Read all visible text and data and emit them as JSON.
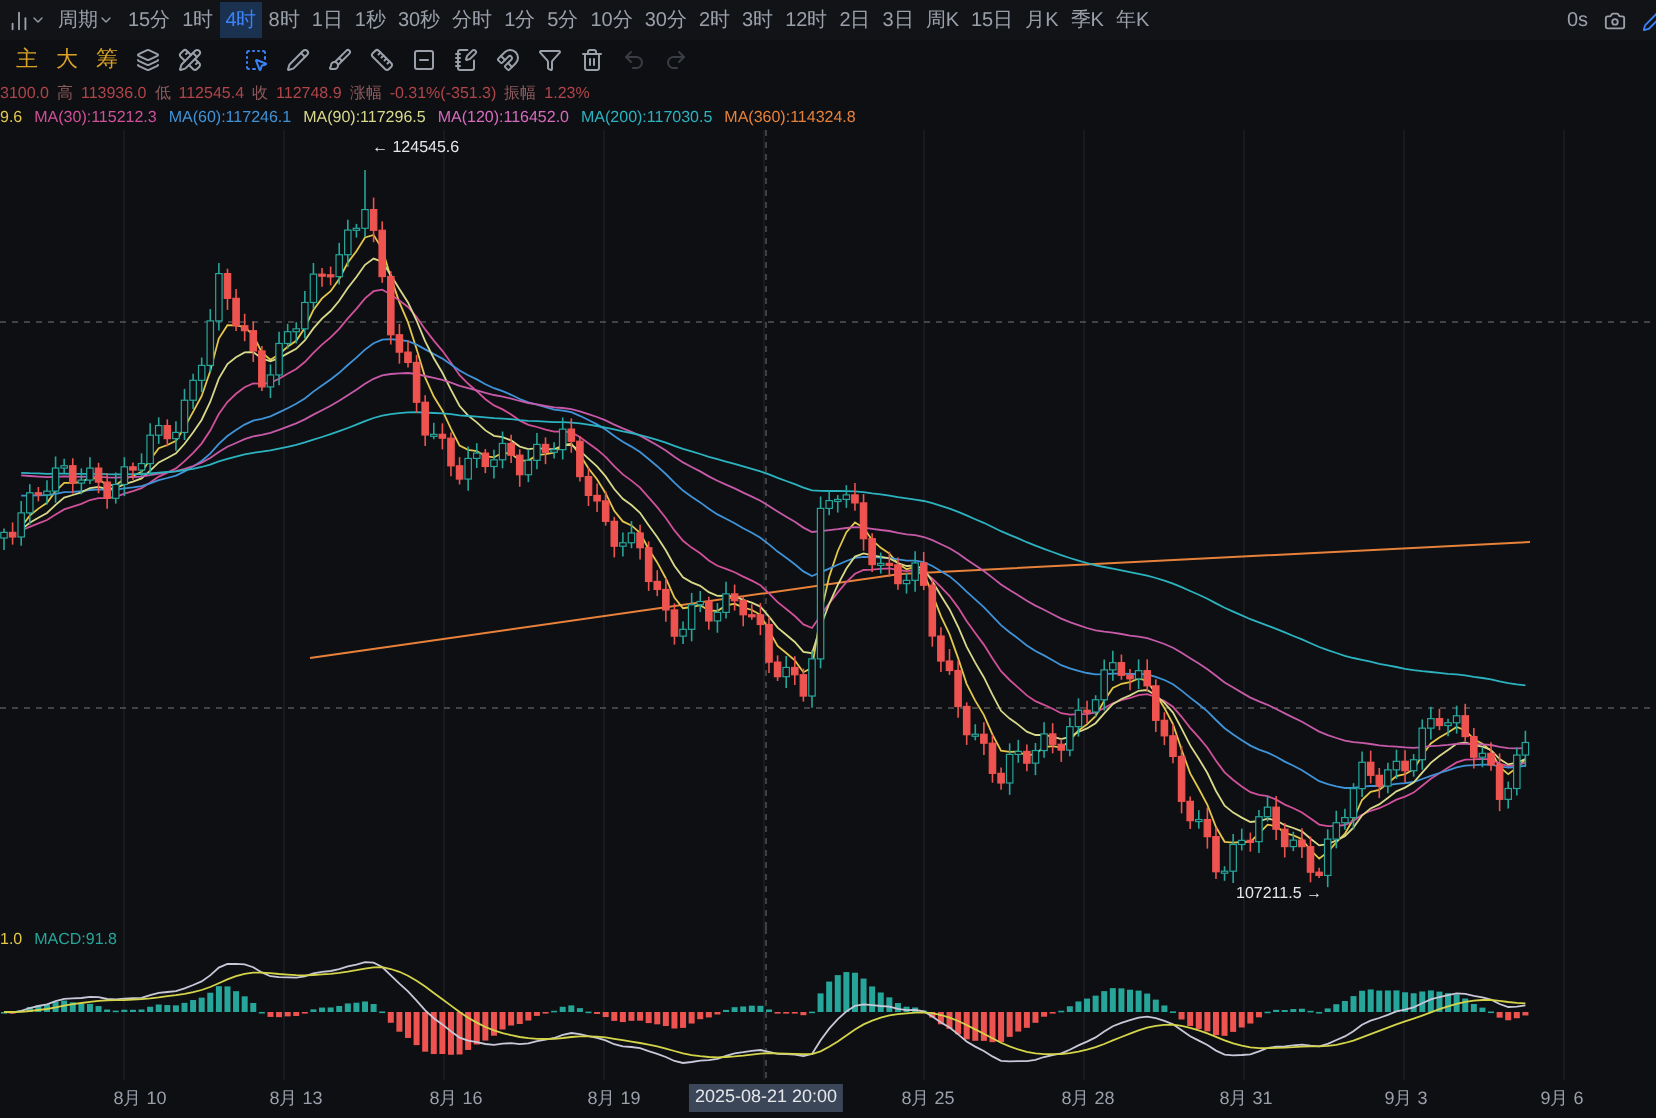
{
  "toolbar": {
    "period_label": "周期",
    "intervals": [
      {
        "label": "15分",
        "selected": false
      },
      {
        "label": "1时",
        "selected": false
      },
      {
        "label": "4时",
        "selected": true
      },
      {
        "label": "8时",
        "selected": false
      },
      {
        "label": "1日",
        "selected": false
      },
      {
        "label": "1秒",
        "selected": false
      },
      {
        "label": "30秒",
        "selected": false
      },
      {
        "label": "分时",
        "selected": false
      },
      {
        "label": "1分",
        "selected": false
      },
      {
        "label": "5分",
        "selected": false
      },
      {
        "label": "10分",
        "selected": false
      },
      {
        "label": "30分",
        "selected": false
      },
      {
        "label": "2时",
        "selected": false
      },
      {
        "label": "3时",
        "selected": false
      },
      {
        "label": "12时",
        "selected": false
      },
      {
        "label": "2日",
        "selected": false
      },
      {
        "label": "3日",
        "selected": false
      },
      {
        "label": "周K",
        "selected": false
      },
      {
        "label": "15日",
        "selected": false
      },
      {
        "label": "月K",
        "selected": false
      },
      {
        "label": "季K",
        "selected": false
      },
      {
        "label": "年K",
        "selected": false
      }
    ],
    "refresh": "0s"
  },
  "indicator_tabs": [
    "主",
    "大",
    "筹"
  ],
  "tools": [
    {
      "kind": "layers",
      "selected": false
    },
    {
      "kind": "ruler",
      "selected": false
    },
    {
      "kind": "select",
      "selected": true
    },
    {
      "kind": "pencil",
      "selected": false
    },
    {
      "kind": "brush",
      "selected": false
    },
    {
      "kind": "measure",
      "selected": false
    },
    {
      "kind": "box",
      "selected": false
    },
    {
      "kind": "note",
      "selected": false
    },
    {
      "kind": "magnet",
      "selected": false
    },
    {
      "kind": "filter",
      "selected": false
    },
    {
      "kind": "trash",
      "selected": false
    }
  ],
  "undo": {
    "disabled": true
  },
  "redo": {
    "disabled": true
  },
  "quote": [
    {
      "value": "3100.0"
    },
    {
      "label": "高",
      "value": "113936.0"
    },
    {
      "label": "低",
      "value": "112545.4"
    },
    {
      "label": "收",
      "value": "112748.9"
    },
    {
      "label": "涨幅",
      "value": "-0.31%(-351.3)"
    },
    {
      "label": "振幅",
      "value": "1.23%"
    }
  ],
  "moving_averages": [
    {
      "text": "9.6",
      "color": "#e3c64a"
    },
    {
      "text": "MA(30):115212.3",
      "color": "#d0509a"
    },
    {
      "text": "MA(60):117246.1",
      "color": "#3f93d8"
    },
    {
      "text": "MA(90):117296.5",
      "color": "#d9d98a"
    },
    {
      "text": "MA(120):116452.0",
      "color": "#d86ac0"
    },
    {
      "text": "MA(200):117030.5",
      "color": "#2bb3c0"
    },
    {
      "text": "MA(360):114324.8",
      "color": "#e8823a"
    }
  ],
  "chart": {
    "high_marker": "← 124545.6",
    "low_marker": "107211.5 →"
  },
  "macd": {
    "values": [
      {
        "text": "1.0",
        "color": "#e3c64a"
      },
      {
        "text": "MACD:91.8",
        "color": "#26a69a"
      }
    ]
  },
  "x_axis": [
    {
      "kind": "tick",
      "text": "8月 10"
    },
    {
      "kind": "tick",
      "text": "8月 13"
    },
    {
      "kind": "tick",
      "text": "8月 16"
    },
    {
      "kind": "tick",
      "text": "8月 19"
    },
    {
      "kind": "crosshair",
      "text": "2025-08-21 20:00"
    },
    {
      "kind": "tick",
      "text": "8月 25"
    },
    {
      "kind": "tick",
      "text": "8月 28"
    },
    {
      "kind": "tick",
      "text": "8月 31"
    },
    {
      "kind": "tick",
      "text": "9月 3"
    },
    {
      "kind": "tick",
      "text": "9月 6"
    }
  ]
}
